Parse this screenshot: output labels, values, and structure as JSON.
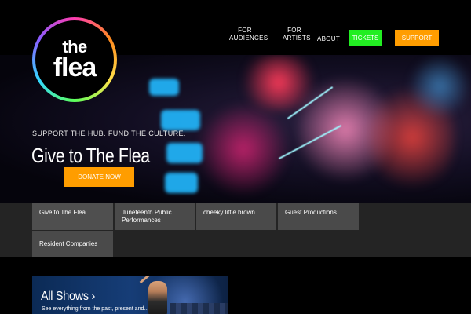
{
  "logo": {
    "line1": "the",
    "line2": "flea"
  },
  "nav": {
    "for_audiences": "FOR\nAUDIENCES",
    "for_artists": "FOR\nARTISTS",
    "about": "ABOUT",
    "tickets": "TICKETS",
    "support": "SUPPORT"
  },
  "hero": {
    "tagline": "SUPPORT THE HUB. FUND THE CULTURE.",
    "title": "Give to The Flea",
    "donate": "DONATE NOW"
  },
  "tiles": [
    {
      "label": "Give to The Flea"
    },
    {
      "label": "Juneteenth Public Performances"
    },
    {
      "label": "cheeky little brown"
    },
    {
      "label": "Guest Productions"
    },
    {
      "label": "Resident Companies"
    }
  ],
  "showcard": {
    "title": "All Shows ›",
    "subtitle": "See everything from the past, present and..."
  },
  "colors": {
    "tickets": "#22ee22",
    "support": "#ff9d00",
    "donate": "#ff9d00",
    "background": "#000000",
    "tile": "#4a4a4a"
  }
}
